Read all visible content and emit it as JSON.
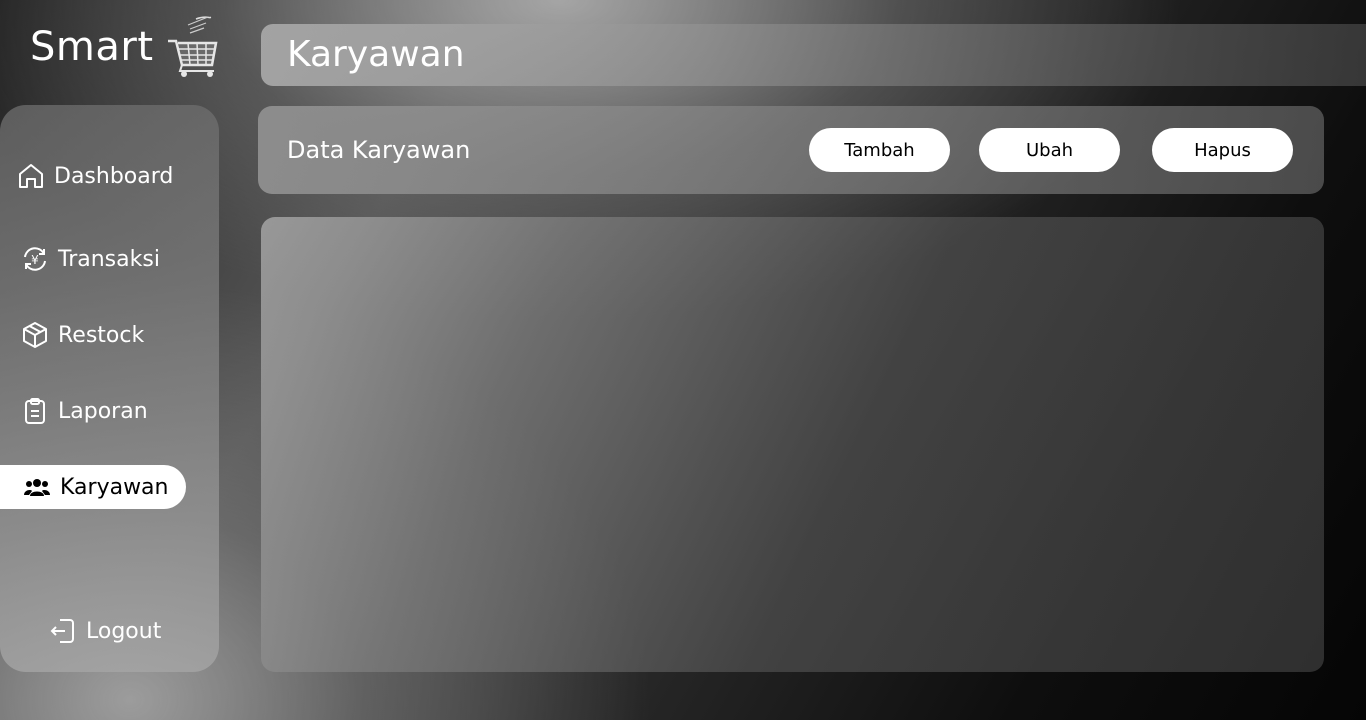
{
  "app": {
    "logo_text": "Smart",
    "logo_icon": "shopping-cart-icon"
  },
  "header": {
    "title": "Karyawan"
  },
  "sidebar": {
    "items": [
      {
        "label": "Dashboard",
        "icon": "home-icon",
        "active": false
      },
      {
        "label": "Transaksi",
        "icon": "currency-exchange-icon",
        "active": false
      },
      {
        "label": "Restock",
        "icon": "box-icon",
        "active": false
      },
      {
        "label": "Laporan",
        "icon": "clipboard-icon",
        "active": false
      },
      {
        "label": "Karyawan",
        "icon": "users-icon",
        "active": true
      }
    ],
    "logout": {
      "label": "Logout",
      "icon": "logout-icon"
    }
  },
  "subheader": {
    "title": "Data Karyawan",
    "buttons": {
      "add": "Tambah",
      "edit": "Ubah",
      "delete": "Hapus"
    }
  },
  "colors": {
    "active_bg": "#ffffff",
    "text": "#ffffff",
    "button_bg": "#ffffff",
    "button_text": "#000000"
  }
}
